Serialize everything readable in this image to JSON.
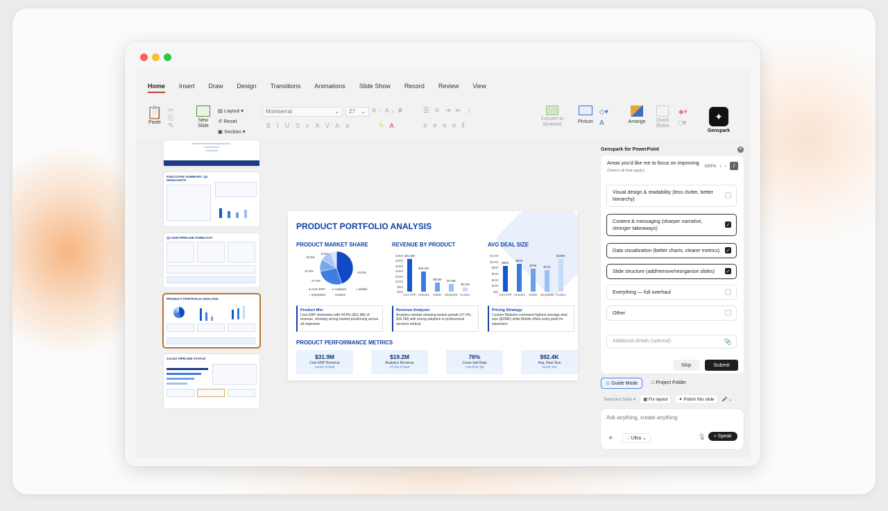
{
  "window": {
    "traffic_colors": [
      "#ff5f57",
      "#febc2e",
      "#28c840"
    ]
  },
  "ribbon": {
    "tabs": [
      "Home",
      "Insert",
      "Draw",
      "Design",
      "Transitions",
      "Animations",
      "Slide Show",
      "Record",
      "Review",
      "View"
    ],
    "active_tab": "Home",
    "paste_label": "Paste",
    "new_slide_label": "New\nSlide",
    "layout_label": "Layout",
    "reset_label": "Reset",
    "section_label": "Section",
    "font_name": "Montserrat",
    "font_size": "27",
    "convert_label": "Convert to\nSmartArt",
    "picture_label": "Picture",
    "arrange_label": "Arrange",
    "quick_styles_label": "Quick\nStyles",
    "genspark_label": "Genspark"
  },
  "slide": {
    "title": "PRODUCT PORTFOLIO ANALYSIS",
    "sections": {
      "market_share": "PRODUCT MARKET SHARE",
      "revenue": "REVENUE BY PRODUCT",
      "deal": "AVG DEAL SIZE",
      "performance": "PRODUCT PERFORMANCE METRICS"
    },
    "pie_labels": [
      "44.8%",
      "27.0%",
      "11.9%",
      "10.5%",
      "5.8%"
    ],
    "pie_legend": [
      "Core ERP",
      "Analytics",
      "Mobile",
      "Integration",
      "Custom"
    ],
    "revenue_ticks": [
      "$35M",
      "$30M",
      "$25M",
      "$20M",
      "$15M",
      "$10M",
      "$5M",
      "$0M"
    ],
    "deal_ticks": [
      "$120K",
      "$100K",
      "$80K",
      "$60K",
      "$40K",
      "$20K",
      "$0K"
    ],
    "insights": [
      {
        "head": "Product Mix:",
        "text": "Core ERP dominates with 44.8% ($31.9M) of revenue, showing strong market positioning across all segments"
      },
      {
        "head": "Revenue Analysis:",
        "text": "Analytics module showing fastest growth (27.0%, $19.2M) with strong adoption in professional services vertical"
      },
      {
        "head": "Pricing Strategy:",
        "text": "Custom Modules command highest average deal size ($108K) while Mobile offers entry-point for expansion"
      }
    ],
    "metrics": [
      {
        "value": "$31.9M",
        "label": "Core ERP Revenue",
        "sub": "44.8% of total"
      },
      {
        "value": "$19.2M",
        "label": "Analytics Revenue",
        "sub": "27.0% of total"
      },
      {
        "value": "76%",
        "label": "Cross-Sell Rate",
        "sub": "+3% from Q4"
      },
      {
        "value": "$92.4K",
        "label": "Avg. Deal Size",
        "sub": "+6.6% YoY"
      }
    ]
  },
  "chart_data": [
    {
      "type": "pie",
      "categories": [
        "Core ERP",
        "Analytics",
        "Mobile",
        "Integration",
        "Custom"
      ],
      "values": [
        44.8,
        27.0,
        11.9,
        10.5,
        5.8
      ],
      "title": "PRODUCT MARKET SHARE",
      "legend": "bottom"
    },
    {
      "type": "bar",
      "categories": [
        "Core ERP",
        "Analytics",
        "Mobile",
        "Integration",
        "Custom"
      ],
      "values": [
        31.9,
        19.2,
        8.5,
        7.5,
        4.1
      ],
      "data_labels": [
        "$31.9M",
        "$19.2M",
        "$8.5M",
        "$7.5M",
        "$4.1M"
      ],
      "title": "REVENUE BY PRODUCT",
      "ylim": [
        0,
        35
      ]
    },
    {
      "type": "bar",
      "categories": [
        "Core ERP",
        "Analytics",
        "Mobile",
        "Integration",
        "Custom"
      ],
      "values": [
        85,
        92,
        76,
        72,
        108
      ],
      "data_labels": [
        "$85K",
        "$92K",
        "$76K",
        "$72K",
        "$108K"
      ],
      "title": "AVG DEAL SIZE",
      "ylim": [
        0,
        120
      ]
    }
  ],
  "colors": {
    "brand_blue": "#0e3fa3",
    "bar_shades": [
      "#1158d0",
      "#3a7be0",
      "#6ea0ea",
      "#9cc0f2",
      "#c6dbf8"
    ],
    "pie_shades": [
      "#1149c4",
      "#3f7de0",
      "#7aa7ec",
      "#a8c6f3",
      "#d2e3fa"
    ],
    "accent_selected": "#b8722c"
  },
  "thumbnails": [
    {
      "title": ""
    },
    {
      "title": "EXECUTIVE SUMMARY: Q1 HIGHLIGHTS"
    },
    {
      "title": "Q2 2026 PIPELINE FORECAST"
    },
    {
      "title": "PRODUCT PORTFOLIO ANALYSIS"
    },
    {
      "title": "SALES PIPELINE STATUS"
    }
  ],
  "panel": {
    "title": "Genspark for PowerPoint",
    "question": "Areas you'd like me to focus on improving",
    "question_hint": "(Select all that apply)",
    "zoom": "100%",
    "options": [
      {
        "label": "Visual design & readability (less clutter, better hierarchy)",
        "checked": false
      },
      {
        "label": "Content & messaging (sharper narrative, stronger takeaways)",
        "checked": true
      },
      {
        "label": "Data visualization (better charts, clearer metrics)",
        "checked": true
      },
      {
        "label": "Slide structure (add/remove/reorganize slides)",
        "checked": true
      },
      {
        "label": "Everything — full overhaul",
        "checked": false
      },
      {
        "label": "Other",
        "checked": false
      }
    ],
    "details_placeholder": "Additional details (optional)",
    "skip": "Skip",
    "submit": "Submit",
    "guide_mode": "Guide Mode",
    "project_folder": "Project Folder",
    "selected_slide": "Selected Slide 4",
    "fix_layout": "Fix layout",
    "polish": "Polish this slide",
    "ask_placeholder": "Ask anything, create anything",
    "model": "Ultra",
    "speak": "Speak"
  }
}
